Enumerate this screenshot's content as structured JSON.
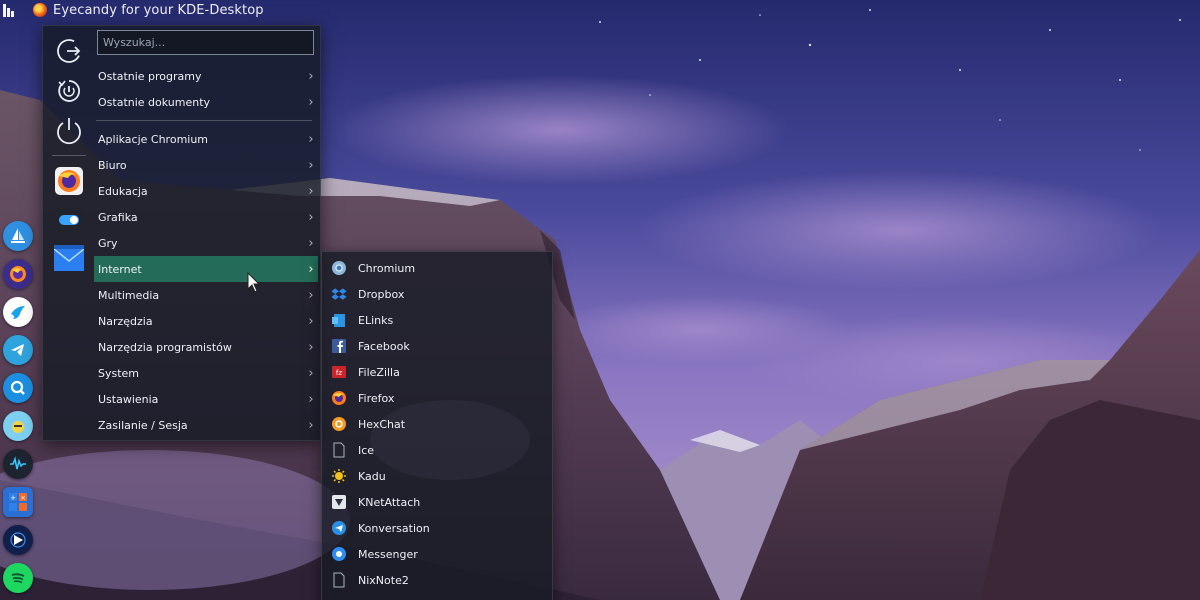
{
  "window": {
    "title": "Eyecandy for your KDE-Desktop"
  },
  "search": {
    "placeholder": "Wyszukaj..."
  },
  "sidebar": {
    "actions": [
      {
        "name": "logout-icon"
      },
      {
        "name": "restart-icon"
      },
      {
        "name": "shutdown-icon"
      }
    ],
    "favorites": [
      {
        "name": "firefox-icon"
      },
      {
        "name": "toggle-icon"
      },
      {
        "name": "mail-icon"
      }
    ]
  },
  "menu": {
    "top_items": [
      {
        "label": "Ostatnie programy"
      },
      {
        "label": "Ostatnie dokumenty"
      }
    ],
    "categories": [
      {
        "label": "Aplikacje Chromium"
      },
      {
        "label": "Biuro"
      },
      {
        "label": "Edukacja"
      },
      {
        "label": "Grafika"
      },
      {
        "label": "Gry"
      },
      {
        "label": "Internet",
        "active": true
      },
      {
        "label": "Multimedia"
      },
      {
        "label": "Narzędzia"
      },
      {
        "label": "Narzędzia programistów"
      },
      {
        "label": "System"
      },
      {
        "label": "Ustawienia"
      },
      {
        "label": "Zasilanie / Sesja"
      }
    ]
  },
  "submenu": {
    "items": [
      {
        "label": "Chromium",
        "icon": "chromium-icon"
      },
      {
        "label": "Dropbox",
        "icon": "dropbox-icon"
      },
      {
        "label": "ELinks",
        "icon": "elinks-icon"
      },
      {
        "label": "Facebook",
        "icon": "facebook-icon"
      },
      {
        "label": "FileZilla",
        "icon": "filezilla-icon"
      },
      {
        "label": "Firefox",
        "icon": "firefox-icon"
      },
      {
        "label": "HexChat",
        "icon": "hexchat-icon"
      },
      {
        "label": "Ice",
        "icon": "ice-icon"
      },
      {
        "label": "Kadu",
        "icon": "kadu-icon"
      },
      {
        "label": "KNetAttach",
        "icon": "knetattach-icon"
      },
      {
        "label": "Konversation",
        "icon": "konversation-icon"
      },
      {
        "label": "Messenger",
        "icon": "messenger-icon"
      },
      {
        "label": "NixNote2",
        "icon": "nixnote-icon"
      }
    ]
  },
  "dock": {
    "items": [
      {
        "name": "sailboat-app-icon"
      },
      {
        "name": "firefox-dock-icon"
      },
      {
        "name": "bird-app-icon"
      },
      {
        "name": "telegram-icon"
      },
      {
        "name": "search-app-icon"
      },
      {
        "name": "emoji-app-icon"
      },
      {
        "name": "audio-wave-icon"
      },
      {
        "name": "calculator-icon"
      },
      {
        "name": "media-player-icon"
      },
      {
        "name": "spotify-icon"
      }
    ]
  },
  "colors": {
    "accent_active": "#247660",
    "menu_bg": "#161b26"
  }
}
